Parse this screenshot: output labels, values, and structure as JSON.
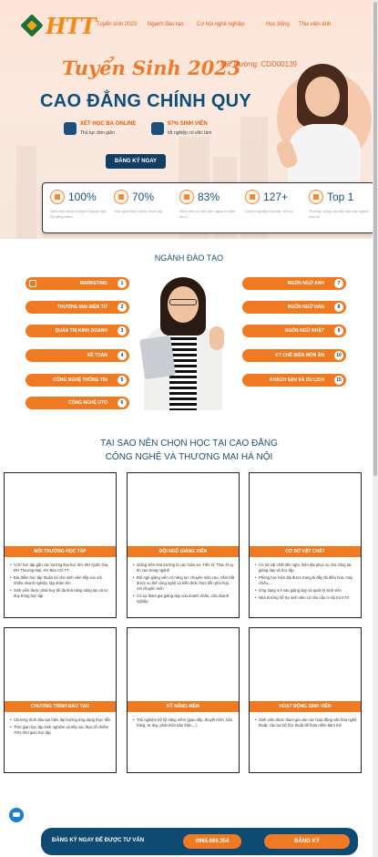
{
  "nav": {
    "logo": "HTT",
    "links": [
      "Tuyển sinh 2023",
      "Ngành đào tạo",
      "Cơ hội nghề nghiệp",
      "Học bổng",
      "Thư viện ảnh"
    ]
  },
  "hero": {
    "slogan": "Tuyển Sinh 2023",
    "school_code": "Mã Trường: CDD00139",
    "headline": "CAO ĐẲNG CHÍNH QUY",
    "feature1_title": "XÉT HỌC BẠ ONLINE",
    "feature1_sub": "Thủ tục đơn giản",
    "feature2_title": "97% SINH VIÊN",
    "feature2_sub": "tốt nghiệp có việc làm",
    "register_button": "ĐĂNG KÝ NGAY"
  },
  "stats": [
    {
      "value": "100%",
      "desc": "Sinh viên được trang bị Ngoại ngữ, Kỹ năng mềm",
      "icon": "trophy-icon"
    },
    {
      "value": "70%",
      "desc": "Thời gian thực hành, thực tập",
      "icon": "practice-icon"
    },
    {
      "value": "83%",
      "desc": "Sinh viên có việc làm ngay từ năm thứ 2",
      "icon": "document-icon"
    },
    {
      "value": "127+",
      "desc": "Doanh nghiệp hợp tác, hỗ trợ",
      "icon": "handshake-icon"
    },
    {
      "value": "Top 1",
      "desc": "Trường Công Lập đào tạo các ngành kinh tế",
      "icon": "medal-icon"
    }
  ],
  "programs": {
    "title": "NGÀNH ĐÀO TẠO",
    "left": [
      {
        "label": "MARKETING",
        "num": "1"
      },
      {
        "label": "THƯƠNG MẠI ĐIỆN TỬ",
        "num": "2"
      },
      {
        "label": "QUẢN TRỊ KINH DOANH",
        "num": "3"
      },
      {
        "label": "KẾ TOÁN",
        "num": "4"
      },
      {
        "label": "CÔNG NGHỆ THÔNG TIN",
        "num": "5"
      },
      {
        "label": "CÔNG NGHỆ OTO",
        "num": "6"
      }
    ],
    "right": [
      {
        "label": "NGÔN NGỮ ANH",
        "num": "7"
      },
      {
        "label": "NGÔN NGỮ HÀN",
        "num": "8"
      },
      {
        "label": "NGÔN NGỮ NHẬT",
        "num": "9"
      },
      {
        "label": "KT CHẾ BIẾN MÓN ĂN",
        "num": "10"
      },
      {
        "label": "KHÁCH SẠN VÀ DU LỊCH",
        "num": "15"
      }
    ]
  },
  "why": {
    "title_line1": "TẠI SAO NÊN CHỌN HỌC TẠI CAO ĐẲNG",
    "title_line2": "CÔNG NGHỆ VÀ THƯƠNG MẠI HÀ NỘI",
    "cards": [
      {
        "title": "MÔI TRƯỜNG HỌC TẬP",
        "items": [
          "Vị trí học tập gần các trường Đại học lớn: ĐH Quốc Gia, ĐH Thương Mại, HV Báo Chí TT...",
          "Địa điểm học tập thuận lợi cho sinh viên tiếp xúc với nhiều doanh nghiệp, tập đoàn lớn",
          "Sinh viên được phát huy tối đa khả năng sáng tạo và tư duy trong học tập"
        ]
      },
      {
        "title": "ĐỘI NGŨ GIẢNG VIÊN",
        "items": [
          "Giảng viên nhà trường là các Giáo sư, Tiến sĩ, Thạc sĩ uy tín cao trong ngành",
          "Đội ngũ giảng viên có năng lực chuyên môn cao, nắm bắt được xu thế công nghệ và kiến thức thực tiễn phù hợp với chuyên môn",
          "Có sự tham gia giảng dạy của doanh nhân, chủ doanh nghiệp"
        ]
      },
      {
        "title": "CƠ SỞ VẬT CHẤT",
        "items": [
          "Cơ sở vật chất tiên nghi, hiện đại phục vụ cho công tác giảng dạy và học tập",
          "Phòng học hiện đại được trang bị đầy đủ điều hòa, máy chiếu,...",
          "Ứng dụng 4.0 vào giảng dạy và quản lý sinh viên",
          "Nhà trường hỗ trợ sinh viên có nhu cầu ở nội trú KTX"
        ]
      },
      {
        "title": "CHƯƠNG TRÌNH ĐÀO TẠO",
        "items": [
          "Chương trình đào tạo hiện đại hướng ứng dụng thực tiễn",
          "Thời gian học tập kinh nghiệm và tiếp xúc thực tế chiếm 70% thời gian học tập"
        ]
      },
      {
        "title": "KỸ NĂNG MỀM",
        "items": [
          "Trải nghiệm bộ kỹ năng mềm (giao tiếp, thuyết trình, bán hàng, tư duy, phát triển bản thân,...)"
        ]
      },
      {
        "title": "HOẠT ĐỘNG SINH VIÊN",
        "items": [
          "Sinh viên được tham gia vào các hoạt động văn hóa nghệ thuật, câu lạc bộ học thuật để thỏa niềm đam mê"
        ]
      }
    ]
  },
  "cta": {
    "text": "ĐĂNG KÝ NGAY ĐỂ ĐƯỢC TƯ VẤN",
    "phone": "0965.666.354",
    "signup": "ĐĂNG KÝ"
  },
  "colors": {
    "orange": "#ef7a22",
    "navy": "#0f4a72"
  }
}
